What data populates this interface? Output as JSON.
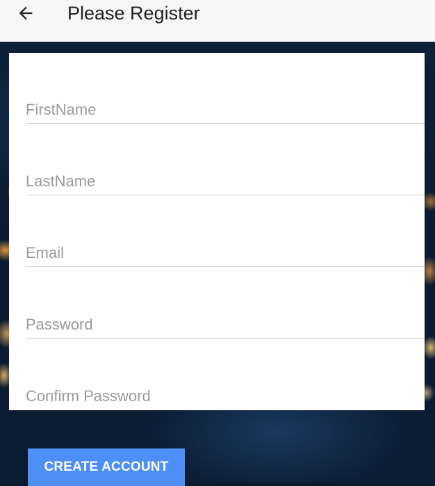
{
  "header": {
    "title": "Please Register",
    "back_icon": "arrow-left-icon"
  },
  "form": {
    "fields": [
      {
        "placeholder": "FirstName",
        "value": ""
      },
      {
        "placeholder": "LastName",
        "value": ""
      },
      {
        "placeholder": "Email",
        "value": ""
      },
      {
        "placeholder": "Password",
        "value": ""
      },
      {
        "placeholder": "Confirm Password",
        "value": ""
      }
    ],
    "submit_label": "CREATE ACCOUNT"
  },
  "colors": {
    "accent": "#4d8ff5",
    "header_bg": "#f6f6f6",
    "card_bg": "#ffffff"
  }
}
